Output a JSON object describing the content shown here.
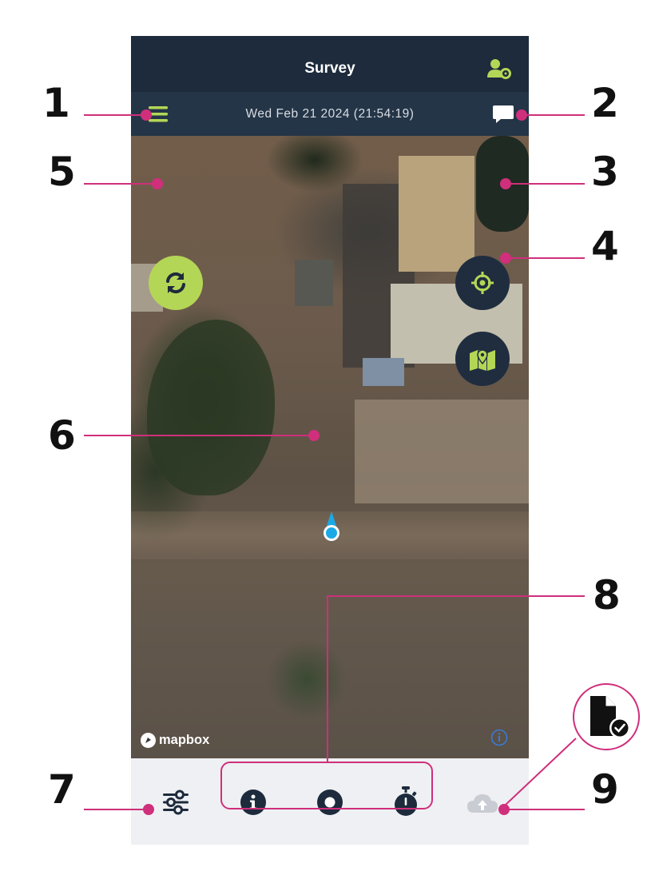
{
  "app": {
    "title": "Survey",
    "datetime": "Wed Feb 21 2024 (21:54:19)",
    "icons": {
      "account": "user-settings-icon",
      "menu": "hamburger-menu-icon",
      "chat": "chat-bubble-icon",
      "refresh": "refresh-icon",
      "locate": "crosshair-icon",
      "layers": "map-layers-icon",
      "location": "current-location-marker",
      "settings": "sliders-icon",
      "info": "info-icon",
      "record": "record-icon",
      "timer": "stopwatch-icon",
      "upload": "cloud-upload-icon",
      "document": "document-check-icon"
    }
  },
  "map": {
    "attribution_logo": "mapbox"
  },
  "callouts": [
    "1",
    "2",
    "3",
    "4",
    "5",
    "6",
    "7",
    "8",
    "9"
  ],
  "colors": {
    "header": "#1d2b3c",
    "subheader": "#243547",
    "accent_green": "#b4d656",
    "fab_dark": "#1f2d3f",
    "callout_pink": "#cf2f7b",
    "location_blue": "#1aa9e6",
    "bottom_bar": "#eff0f3"
  }
}
